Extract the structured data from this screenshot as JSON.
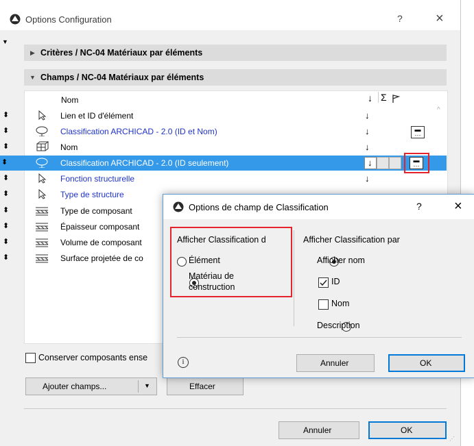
{
  "main": {
    "title": "Options Configuration",
    "help": "?",
    "close": "×",
    "criteria_label": "Critères / NC-04 Matériaux par éléments",
    "fields_label": "Champs / NC-04 Matériaux par éléments",
    "col_name": "Nom",
    "col_arrow": "↓",
    "col_sum": "Σ",
    "rows": [
      {
        "label": "Lien et ID d'élément",
        "icon": "pointer-icon",
        "link": false,
        "arrow": "↓",
        "options": false
      },
      {
        "label": "Classification ARCHICAD - 2.0 (ID et Nom)",
        "icon": "classification-icon",
        "link": true,
        "arrow": "↓",
        "options": true
      },
      {
        "label": "Nom",
        "icon": "object-icon",
        "link": false,
        "arrow": "↓",
        "options": false
      },
      {
        "label": "Classification ARCHICAD - 2.0 (ID seulement)",
        "icon": "classification-icon",
        "link": true,
        "arrow": "↓",
        "options": true,
        "selected": true
      },
      {
        "label": "Fonction structurelle",
        "icon": "pointer-icon",
        "link": true,
        "arrow": "↓",
        "options": false
      },
      {
        "label": "Type de structure",
        "icon": "pointer-icon",
        "link": true,
        "arrow": "",
        "options": false
      },
      {
        "label": "Type de composant",
        "icon": "layers-icon",
        "link": false,
        "arrow": "",
        "options": false
      },
      {
        "label": "Épaisseur composant",
        "icon": "layers-icon",
        "link": false,
        "arrow": "",
        "options": false
      },
      {
        "label": "Volume de composant",
        "icon": "layers-icon",
        "link": false,
        "arrow": "",
        "options": false
      },
      {
        "label": "Surface projetée de co",
        "icon": "layers-icon",
        "link": false,
        "arrow": "",
        "options": false
      }
    ],
    "keep_components": "Conserver composants ense",
    "add_fields": "Ajouter champs...",
    "clear": "Effacer",
    "cancel": "Annuler",
    "ok": "OK"
  },
  "dialog": {
    "title": "Options de champ de Classification",
    "help": "?",
    "close": "×",
    "left_heading": "Afficher Classification d",
    "opt_element": "Élément",
    "opt_material_1": "Matériau de",
    "opt_material_2": "construction",
    "right_heading": "Afficher Classification par",
    "opt_show_name": "Afficher nom",
    "chk_id": "ID",
    "chk_name": "Nom",
    "opt_description": "Description",
    "info": "i",
    "cancel": "Annuler",
    "ok": "OK"
  },
  "colors": {
    "selection": "#3399e8",
    "link": "#1f33c8",
    "highlight": "#e4242d",
    "accent": "#0078d7"
  }
}
